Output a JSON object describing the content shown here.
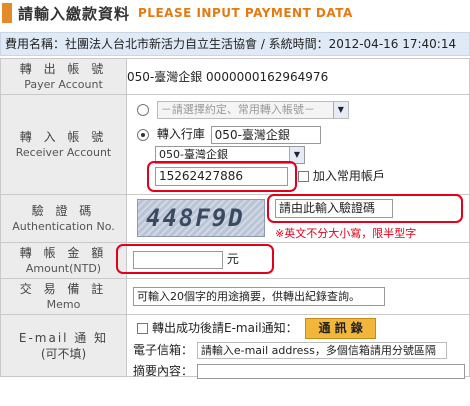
{
  "header": {
    "title_cn": "請輸入繳款資料",
    "title_en": "PLEASE INPUT PAYMENT DATA"
  },
  "info_bar": "費用名稱：社團法人台北市新活力自立生活協會 / 系統時間：2012-04-16 17:40:14",
  "payer": {
    "label_zh": "轉 出 帳 號",
    "label_en": "Payer Account",
    "value": "050-臺灣企銀 0000000162964976"
  },
  "receiver": {
    "label_zh": "轉 入 帳 號",
    "label_en": "Receiver Account",
    "preset_select": "－請選擇約定、常用轉入帳號－",
    "bank_label": "轉入行庫",
    "bank_field": "050-臺灣企銀",
    "bank_select": "050-臺灣企銀",
    "account_value": "15262427886",
    "add_frequent_label": "加入常用帳戶"
  },
  "auth": {
    "label_zh": "驗 證 碼",
    "label_en": "Authentication No.",
    "captcha_text": "448F9D",
    "placeholder": "請由此輸入驗證碼",
    "warning": "※英文不分大小寫，限半型字"
  },
  "amount": {
    "label_zh": "轉 帳 金 額",
    "label_en": "Amount(NTD)",
    "value": "",
    "unit": "元"
  },
  "memo": {
    "label_zh": "交 易 備 註",
    "label_en": "Memo",
    "placeholder": "可輸入20個字的用途摘要，供轉出紀錄查詢。"
  },
  "email": {
    "label_zh": "E-mail 通 知",
    "label_sub": "(可不填)",
    "notify_label": "轉出成功後請E-mail通知：",
    "address_book_button": "通 訊 錄",
    "mailbox_label": "電子信箱：",
    "mailbox_placeholder": "請輸入e-mail address，多個信箱請用分號區隔",
    "summary_label": "摘要內容："
  },
  "colors": {
    "accent": "#e47a12",
    "highlight_ring": "#e4001b",
    "label_bg": "#ececec",
    "info_bg": "#dfeaf6"
  }
}
